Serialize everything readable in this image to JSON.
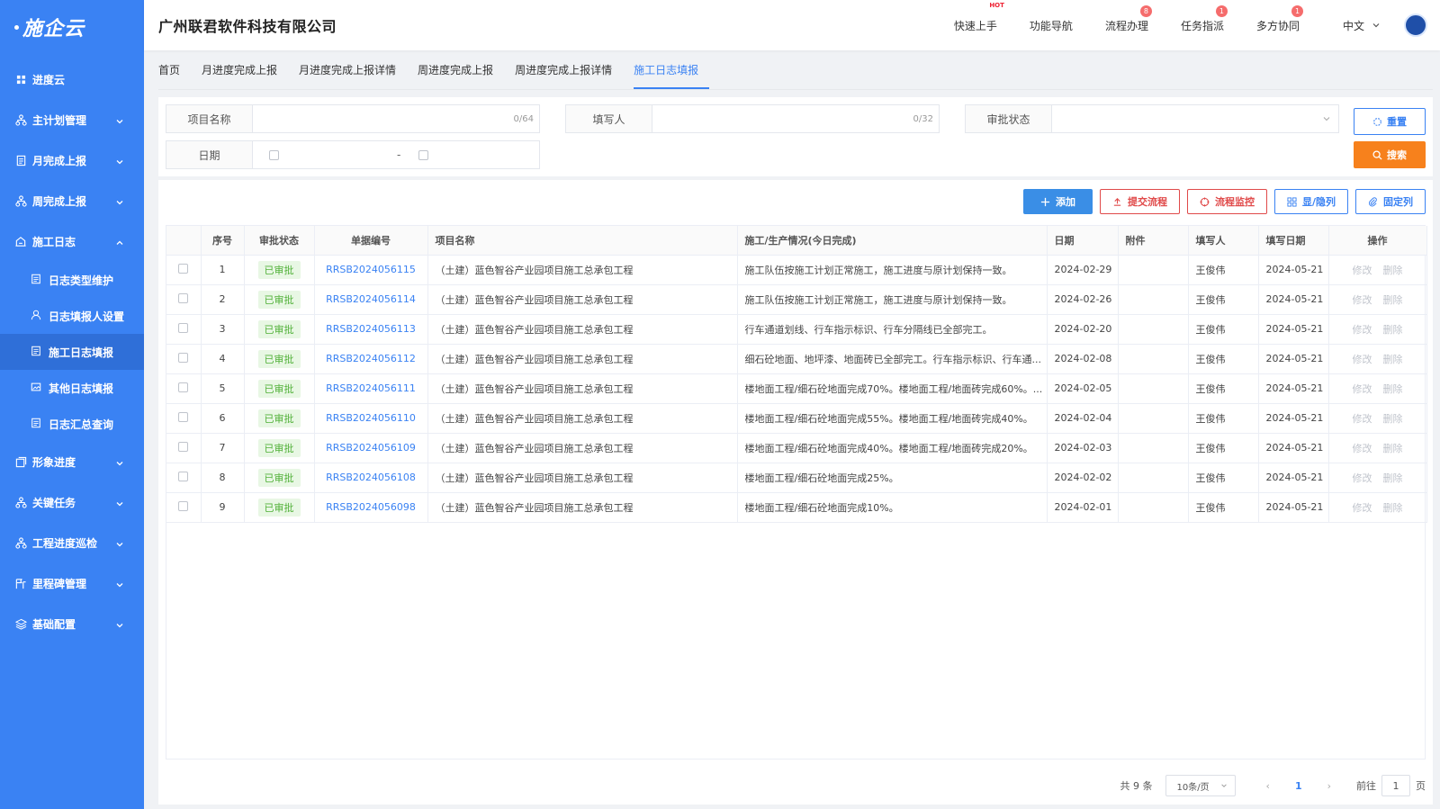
{
  "app": {
    "logo": "施企云",
    "company": "广州联君软件科技有限公司"
  },
  "header_nav": [
    {
      "label": "快速上手",
      "badge": "HOT"
    },
    {
      "label": "功能导航",
      "badge": ""
    },
    {
      "label": "流程办理",
      "badge": "8"
    },
    {
      "label": "任务指派",
      "badge": "1"
    },
    {
      "label": "多方协同",
      "badge": "1"
    }
  ],
  "language": "中文",
  "sidebar": {
    "items": [
      {
        "label": "进度云",
        "icon": "grid-icon",
        "expandable": false
      },
      {
        "label": "主计划管理",
        "icon": "org-icon",
        "expandable": true
      },
      {
        "label": "月完成上报",
        "icon": "doc-icon",
        "expandable": true
      },
      {
        "label": "周完成上报",
        "icon": "org-icon",
        "expandable": true
      },
      {
        "label": "施工日志",
        "icon": "log-icon",
        "expandable": true,
        "open": true
      }
    ],
    "subitems": [
      {
        "label": "日志类型维护",
        "icon": "list-icon"
      },
      {
        "label": "日志填报人设置",
        "icon": "user-icon"
      },
      {
        "label": "施工日志填报",
        "icon": "list-icon",
        "active": true
      },
      {
        "label": "其他日志填报",
        "icon": "image-icon"
      },
      {
        "label": "日志汇总查询",
        "icon": "list-icon"
      }
    ],
    "items_after": [
      {
        "label": "形象进度",
        "icon": "photos-icon"
      },
      {
        "label": "关键任务",
        "icon": "org-icon"
      },
      {
        "label": "工程进度巡检",
        "icon": "org-icon"
      },
      {
        "label": "里程碑管理",
        "icon": "milestone-icon"
      },
      {
        "label": "基础配置",
        "icon": "layers-icon"
      }
    ]
  },
  "tabs": [
    "首页",
    "月进度完成上报",
    "月进度完成上报详情",
    "周进度完成上报",
    "周进度完成上报详情",
    "施工日志填报"
  ],
  "active_tab": "施工日志填报",
  "filters": {
    "project_label": "项目名称",
    "project_count": "0/64",
    "writer_label": "填写人",
    "writer_count": "0/32",
    "status_label": "审批状态",
    "date_label": "日期",
    "date_sep": "-",
    "reset_label": "重置",
    "search_label": "搜索"
  },
  "toolbar": {
    "add": "添加",
    "submit": "提交流程",
    "monitor": "流程监控",
    "toggle_cols": "显/隐列",
    "fix_cols": "固定列"
  },
  "table": {
    "headers": [
      "",
      "序号",
      "审批状态",
      "单据编号",
      "项目名称",
      "施工/生产情况(今日完成)",
      "日期",
      "附件",
      "填写人",
      "填写日期",
      "操作"
    ],
    "edit_label": "修改",
    "delete_label": "删除",
    "rows": [
      {
        "no": "1",
        "status": "已审批",
        "code": "RRSB2024056115",
        "project": "（土建）蓝色智谷产业园项目施工总承包工程",
        "desc": "施工队伍按施工计划正常施工，施工进度与原计划保持一致。",
        "date": "2024-02-29",
        "attach": "",
        "writer": "王俊伟",
        "fill_date": "2024-05-21"
      },
      {
        "no": "2",
        "status": "已审批",
        "code": "RRSB2024056114",
        "project": "（土建）蓝色智谷产业园项目施工总承包工程",
        "desc": "施工队伍按施工计划正常施工，施工进度与原计划保持一致。",
        "date": "2024-02-26",
        "attach": "",
        "writer": "王俊伟",
        "fill_date": "2024-05-21"
      },
      {
        "no": "3",
        "status": "已审批",
        "code": "RRSB2024056113",
        "project": "（土建）蓝色智谷产业园项目施工总承包工程",
        "desc": "行车通道划线、行车指示标识、行车分隔线已全部完工。",
        "date": "2024-02-20",
        "attach": "",
        "writer": "王俊伟",
        "fill_date": "2024-05-21"
      },
      {
        "no": "4",
        "status": "已审批",
        "code": "RRSB2024056112",
        "project": "（土建）蓝色智谷产业园项目施工总承包工程",
        "desc": "细石砼地面、地坪漆、地面砖已全部完工。行车指示标识、行车通...",
        "date": "2024-02-08",
        "attach": "",
        "writer": "王俊伟",
        "fill_date": "2024-05-21"
      },
      {
        "no": "5",
        "status": "已审批",
        "code": "RRSB2024056111",
        "project": "（土建）蓝色智谷产业园项目施工总承包工程",
        "desc": "楼地面工程/细石砼地面完成70%。楼地面工程/地面砖完成60%。...",
        "date": "2024-02-05",
        "attach": "",
        "writer": "王俊伟",
        "fill_date": "2024-05-21"
      },
      {
        "no": "6",
        "status": "已审批",
        "code": "RRSB2024056110",
        "project": "（土建）蓝色智谷产业园项目施工总承包工程",
        "desc": "楼地面工程/细石砼地面完成55%。楼地面工程/地面砖完成40%。",
        "date": "2024-02-04",
        "attach": "",
        "writer": "王俊伟",
        "fill_date": "2024-05-21"
      },
      {
        "no": "7",
        "status": "已审批",
        "code": "RRSB2024056109",
        "project": "（土建）蓝色智谷产业园项目施工总承包工程",
        "desc": "楼地面工程/细石砼地面完成40%。楼地面工程/地面砖完成20%。",
        "date": "2024-02-03",
        "attach": "",
        "writer": "王俊伟",
        "fill_date": "2024-05-21"
      },
      {
        "no": "8",
        "status": "已审批",
        "code": "RRSB2024056108",
        "project": "（土建）蓝色智谷产业园项目施工总承包工程",
        "desc": "楼地面工程/细石砼地面完成25%。",
        "date": "2024-02-02",
        "attach": "",
        "writer": "王俊伟",
        "fill_date": "2024-05-21"
      },
      {
        "no": "9",
        "status": "已审批",
        "code": "RRSB2024056098",
        "project": "（土建）蓝色智谷产业园项目施工总承包工程",
        "desc": "楼地面工程/细石砼地面完成10%。",
        "date": "2024-02-01",
        "attach": "",
        "writer": "王俊伟",
        "fill_date": "2024-05-21"
      }
    ]
  },
  "pagination": {
    "total": "共 9 条",
    "page_size": "10条/页",
    "current": "1",
    "goto_label": "前往",
    "goto_value": "1",
    "page_unit": "页"
  },
  "colors": {
    "sidebar": "#3a82f3",
    "accent": "#3a82f3",
    "search": "#f7811c",
    "danger": "#e04a4a",
    "approved_bg": "#e8f7e4",
    "approved_text": "#52b13a"
  }
}
